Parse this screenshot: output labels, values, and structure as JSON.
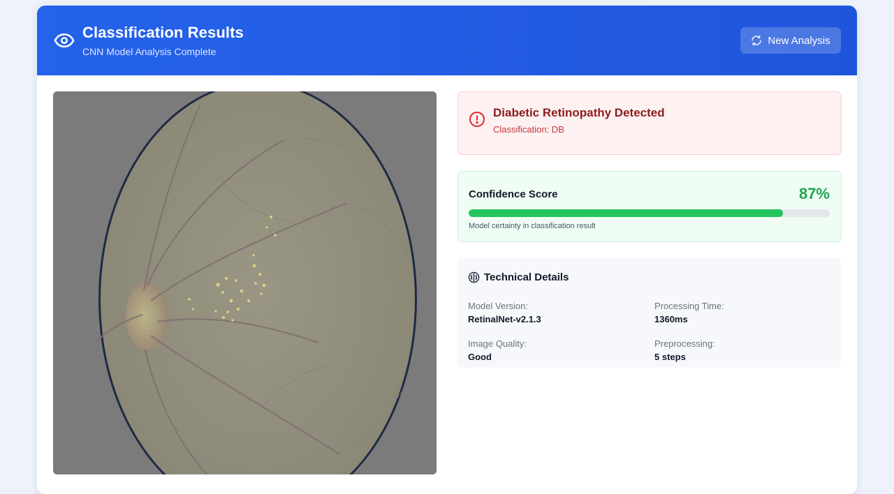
{
  "header": {
    "title": "Classification Results",
    "subtitle": "CNN Model Analysis Complete",
    "new_analysis_label": "New Analysis",
    "eye_icon": "eye-icon",
    "refresh_icon": "refresh-icon"
  },
  "result": {
    "title": "Diabetic Retinopathy Detected",
    "classification": "Classification: DB",
    "icon": "alert-circle-icon"
  },
  "confidence": {
    "label": "Confidence Score",
    "value_text": "87%",
    "percent": 87,
    "note": "Model certainty in classification result"
  },
  "technical": {
    "title": "Technical Details",
    "icon": "brain-icon",
    "model_version_label": "Model Version:",
    "model_version_value": "RetinalNet-v2.1.3",
    "processing_time_label": "Processing Time:",
    "processing_time_value": "1360ms",
    "image_quality_label": "Image Quality:",
    "image_quality_value": "Good",
    "preprocessing_label": "Preprocessing:",
    "preprocessing_value": "5 steps"
  },
  "colors": {
    "header_blue": "#2563eb",
    "alert_red": "#8b1d1d",
    "success_green": "#22c55e",
    "confidence_text": "#22a34f"
  }
}
